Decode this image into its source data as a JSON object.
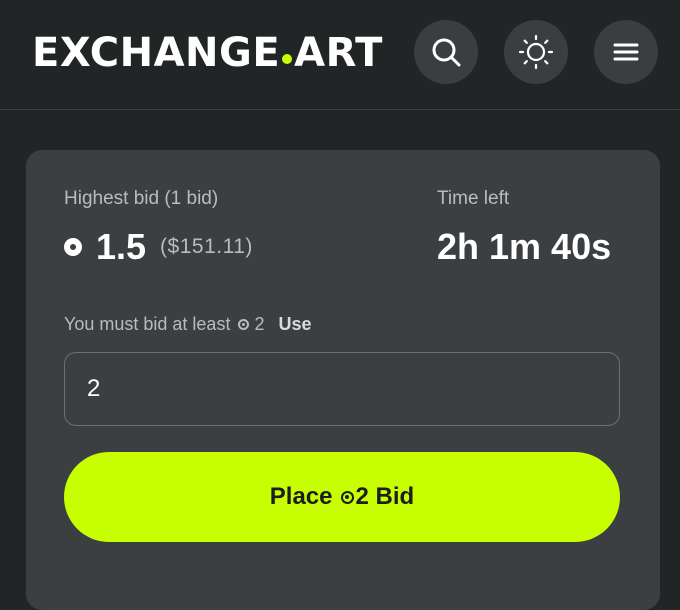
{
  "header": {
    "logo_left": "EXCHANGE",
    "logo_right": "ART",
    "icons": [
      "search-icon",
      "sun-icon",
      "menu-icon"
    ]
  },
  "auction": {
    "highest_bid_label": "Highest bid",
    "bid_count": "(1 bid)",
    "highest_bid_amount": "1.5",
    "highest_bid_usd": "($151.11)",
    "time_left_label": "Time left",
    "time_left_value": "2h 1m 40s",
    "min_bid_prefix": "You must bid at least",
    "min_bid_amount": "2",
    "use_label": "Use"
  },
  "bid_input": {
    "value": "2"
  },
  "place_bid": {
    "prefix": "Place",
    "amount": "2",
    "suffix": "Bid"
  },
  "colors": {
    "accent": "#c8ff00",
    "background": "#222526",
    "card": "#3b3f41"
  }
}
